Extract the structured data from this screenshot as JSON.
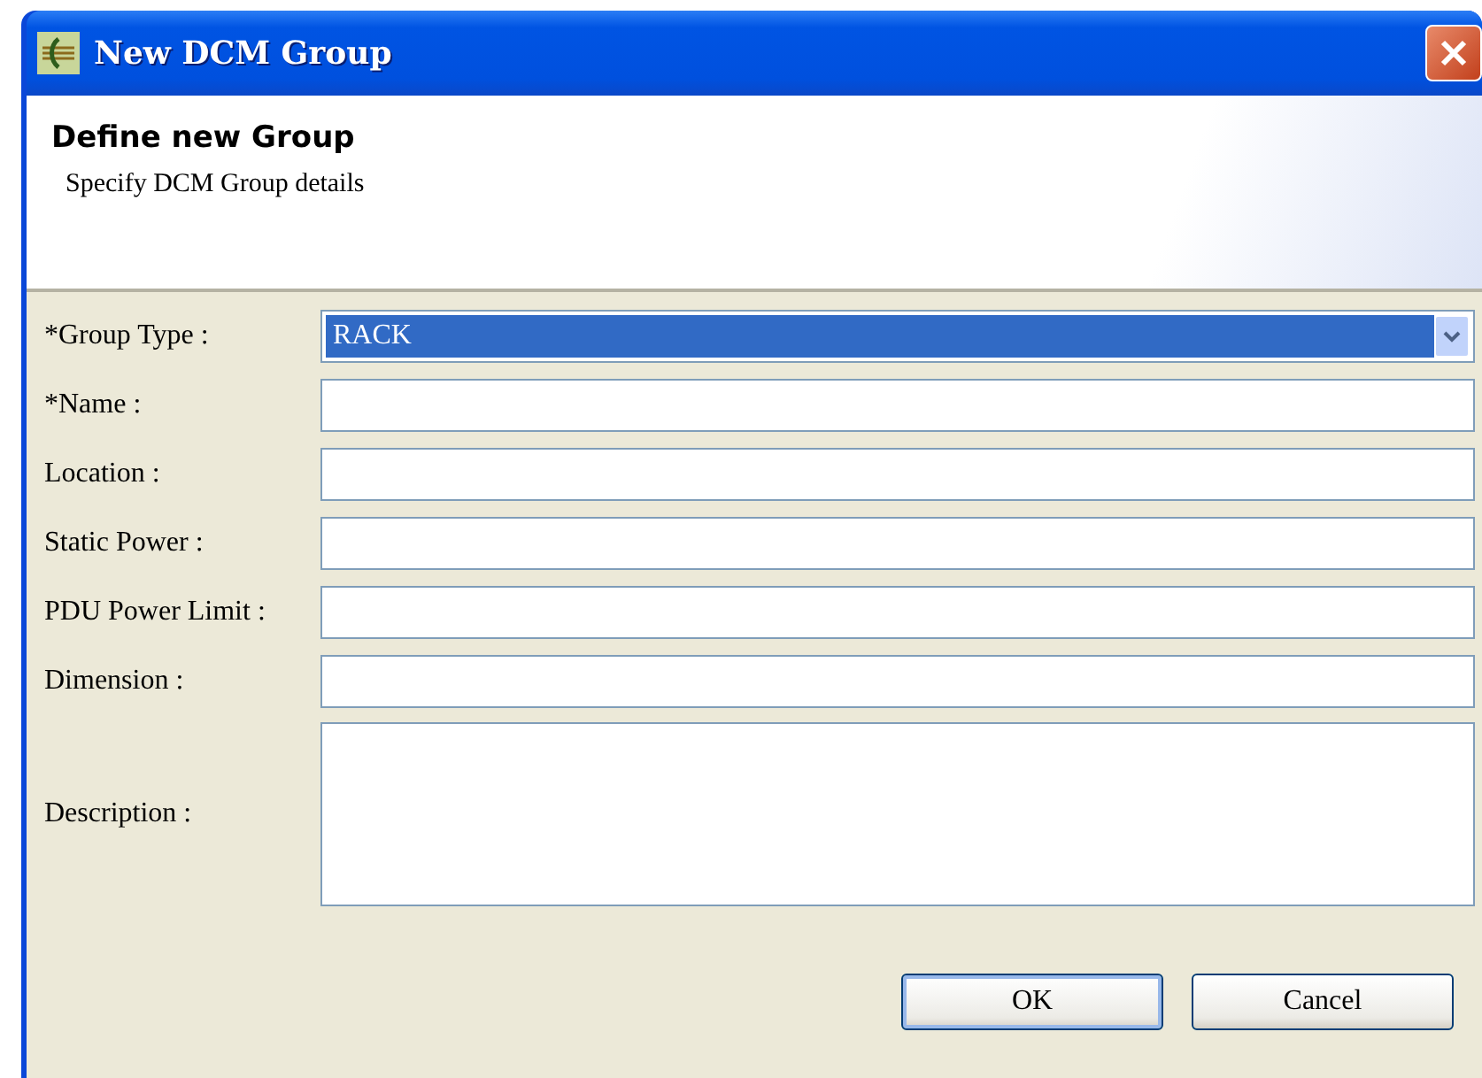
{
  "window": {
    "title": "New DCM Group"
  },
  "header": {
    "title": "Define new Group",
    "subtitle": "Specify DCM Group details"
  },
  "fields": [
    {
      "label": "*Group Type :",
      "kind": "select",
      "value": "RACK",
      "selected": true
    },
    {
      "label": "*Name :",
      "kind": "text"
    },
    {
      "label": "Location :",
      "kind": "text"
    },
    {
      "label": "Static Power :",
      "kind": "text"
    },
    {
      "label": "PDU Power Limit :",
      "kind": "text"
    },
    {
      "label": "Dimension :",
      "kind": "text"
    },
    {
      "label": "Description :",
      "kind": "textarea"
    }
  ],
  "buttons": [
    {
      "label": "OK",
      "default": true
    },
    {
      "label": "Cancel",
      "default": false
    }
  ]
}
